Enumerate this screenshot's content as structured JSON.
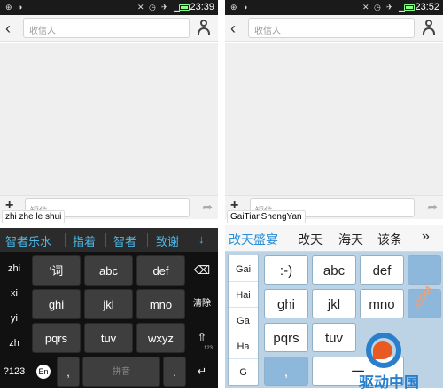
{
  "left": {
    "status": {
      "time": "23:39"
    },
    "recipient_placeholder": "收信人",
    "message_placeholder": "短信",
    "pinyin": "zhi zhe le shui",
    "candidates": [
      "智者乐水",
      "指着",
      "智者",
      "致谢"
    ],
    "candidate_more": "↓",
    "syllables": [
      "zhi",
      "xi",
      "yi",
      "zh"
    ],
    "keys": {
      "row1": [
        "'词",
        "abc",
        "def"
      ],
      "row2": [
        "ghi",
        "jkl",
        "mno"
      ],
      "row3": [
        "pqrs",
        "tuv",
        "wxyz"
      ],
      "backspace": "⌫",
      "clear": "清除",
      "shift": "⇧",
      "shift_sub": "123",
      "sym": "?123",
      "lang": "En",
      "comma": ",",
      "space": "拼音",
      "period": ".",
      "enter": "↵"
    }
  },
  "right": {
    "status": {
      "time": "23:52"
    },
    "recipient_placeholder": "收信人",
    "message_placeholder": "短信",
    "pinyin": "GaiTianShengYan",
    "candidates": [
      "改天盛宴",
      "改天",
      "海天",
      "该条"
    ],
    "candidate_more": "»",
    "syllables": [
      "Gai",
      "Hai",
      "Ga",
      "Ha",
      "G"
    ],
    "keys": {
      "row1": [
        ":-)",
        "abc",
        "def"
      ],
      "row2": [
        "ghi",
        "jkl",
        "mno"
      ],
      "row3": [
        "pqrs",
        "tuv"
      ],
      "comma": ",",
      "space": "一",
      "watermark": ".COM"
    }
  },
  "logo_text": "驱动中国",
  "colors": {
    "left_candidate": "#4db8e8",
    "right_candidate_selected": "#2a8fd8",
    "right_key_blue": "#8db7db"
  }
}
